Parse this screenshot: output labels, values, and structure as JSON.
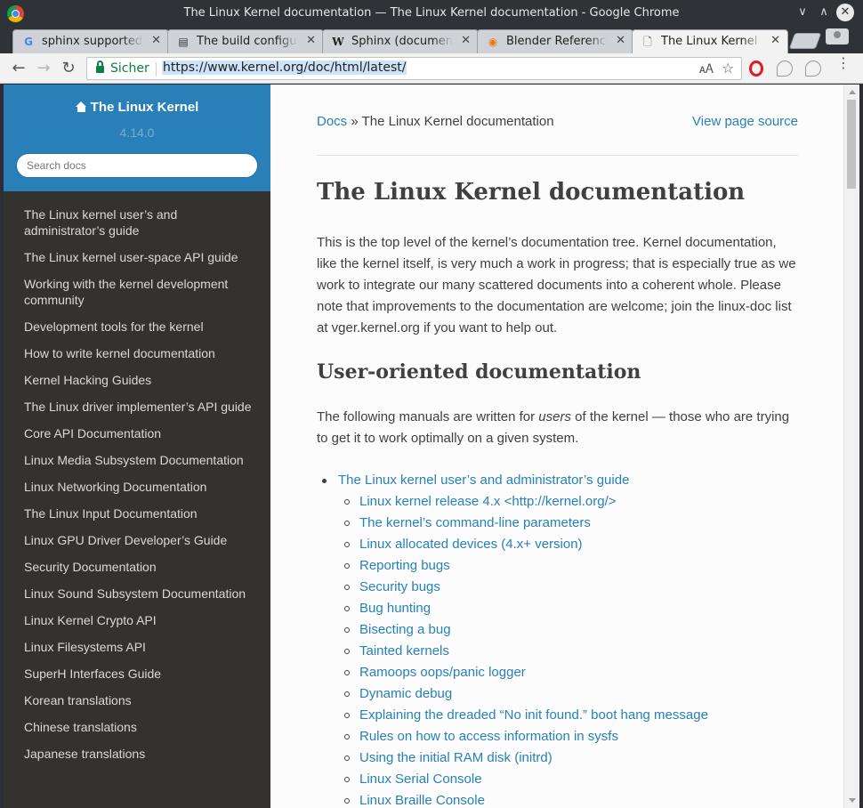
{
  "window": {
    "title": "The Linux Kernel documentation — The Linux Kernel documentation - Google Chrome",
    "minimize": "∨",
    "maximize": "∧",
    "close": "✕"
  },
  "tabs": [
    {
      "label": "sphinx supported languages",
      "icon": "G",
      "close": "✕"
    },
    {
      "label": "The build configuration file",
      "icon": "▤",
      "close": "✕"
    },
    {
      "label": "Sphinx (documentation generator)",
      "icon": "W",
      "close": "✕"
    },
    {
      "label": "Blender Reference Manual",
      "icon": "◉",
      "close": "✕"
    },
    {
      "label": "The Linux Kernel documentation",
      "icon": "🗋",
      "close": "✕"
    }
  ],
  "toolbar": {
    "back": "←",
    "forward": "→",
    "reload": "↻",
    "secure_label": "Sicher",
    "url": "https://www.kernel.org/doc/html/latest/",
    "translate_icon": "🗚",
    "star_icon": "☆",
    "menu": "⋮"
  },
  "sidebar": {
    "project": "The Linux Kernel",
    "version": "4.14.0",
    "search_placeholder": "Search docs",
    "items": [
      "The Linux kernel user’s and administrator’s guide",
      "The Linux kernel user-space API guide",
      "Working with the kernel development community",
      "Development tools for the kernel",
      "How to write kernel documentation",
      "Kernel Hacking Guides",
      "The Linux driver implementer’s API guide",
      "Core API Documentation",
      "Linux Media Subsystem Documentation",
      "Linux Networking Documentation",
      "The Linux Input Documentation",
      "Linux GPU Driver Developer’s Guide",
      "Security Documentation",
      "Linux Sound Subsystem Documentation",
      "Linux Kernel Crypto API",
      "Linux Filesystems API",
      "SuperH Interfaces Guide",
      "Korean translations",
      "Chinese translations",
      "Japanese translations"
    ]
  },
  "content": {
    "breadcrumb_docs": "Docs",
    "breadcrumb_sep": " » ",
    "breadcrumb_current": "The Linux Kernel documentation",
    "view_source": "View page source",
    "title": "The Linux Kernel documentation",
    "intro": "This is the top level of the kernel’s documentation tree. Kernel documentation, like the kernel itself, is very much a work in progress; that is especially true as we work to integrate our many scattered documents into a coherent whole. Please note that improvements to the documentation are welcome; join the linux-doc list at vger.kernel.org if you want to help out.",
    "section_title": "User-oriented documentation",
    "section_intro_before": "The following manuals are written for ",
    "section_intro_em": "users",
    "section_intro_after": " of the kernel — those who are trying to get it to work optimally on a given system.",
    "toc_top": "The Linux kernel user’s and administrator’s guide",
    "toc_sub": [
      "Linux kernel release 4.x <http://kernel.org/>",
      "The kernel’s command-line parameters",
      "Linux allocated devices (4.x+ version)",
      "Reporting bugs",
      "Security bugs",
      "Bug hunting",
      "Bisecting a bug",
      "Tainted kernels",
      "Ramoops oops/panic logger",
      "Dynamic debug",
      "Explaining the dreaded “No init found.” boot hang message",
      "Rules on how to access information in sysfs",
      "Using the initial RAM disk (initrd)",
      "Linux Serial Console",
      "Linux Braille Console"
    ]
  },
  "colors": {
    "link": "#2980b9",
    "sidebar_bg": "#343131",
    "sidebar_header": "#2980b9",
    "secure_green": "#0b8043"
  }
}
